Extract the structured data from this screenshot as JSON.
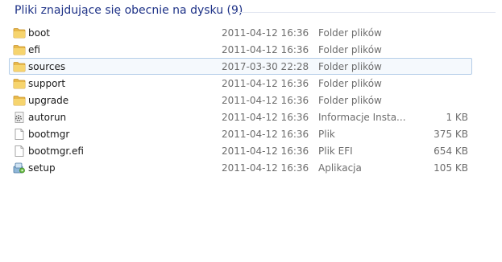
{
  "group": {
    "title": "Pliki znajdujące się obecnie na dysku (9)"
  },
  "files": [
    {
      "name": "boot",
      "date": "2011-04-12 16:36",
      "type": "Folder plików",
      "size": "",
      "icon": "folder-icon"
    },
    {
      "name": "efi",
      "date": "2011-04-12 16:36",
      "type": "Folder plików",
      "size": "",
      "icon": "folder-icon"
    },
    {
      "name": "sources",
      "date": "2017-03-30 22:28",
      "type": "Folder plików",
      "size": "",
      "icon": "folder-icon",
      "selected": true
    },
    {
      "name": "support",
      "date": "2011-04-12 16:36",
      "type": "Folder plików",
      "size": "",
      "icon": "folder-icon"
    },
    {
      "name": "upgrade",
      "date": "2011-04-12 16:36",
      "type": "Folder plików",
      "size": "",
      "icon": "folder-icon"
    },
    {
      "name": "autorun",
      "date": "2011-04-12 16:36",
      "type": "Informacje Insta...",
      "size": "1 KB",
      "icon": "settings-file-icon"
    },
    {
      "name": "bootmgr",
      "date": "2011-04-12 16:36",
      "type": "Plik",
      "size": "375 KB",
      "icon": "blank-file-icon"
    },
    {
      "name": "bootmgr.efi",
      "date": "2011-04-12 16:36",
      "type": "Plik EFI",
      "size": "654 KB",
      "icon": "blank-file-icon"
    },
    {
      "name": "setup",
      "date": "2011-04-12 16:36",
      "type": "Aplikacja",
      "size": "105 KB",
      "icon": "setup-app-icon"
    }
  ]
}
